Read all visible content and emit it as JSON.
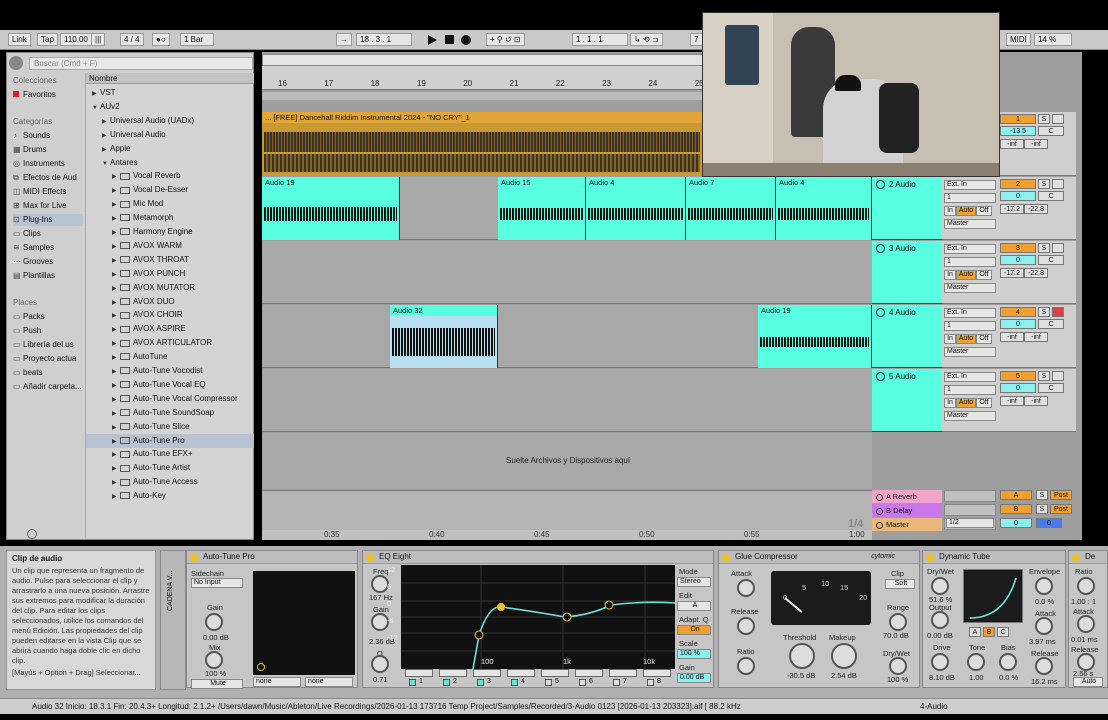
{
  "transport": {
    "link": "Link",
    "tap": "Tap",
    "tempo": "110.00",
    "signature": "4 / 4",
    "quantize": "1 Bar",
    "position": "18 .  3 .  1",
    "loop_start": "1 .  1 .  1",
    "loop_length": "7",
    "midi_label": "MIDI",
    "cpu": "14 %"
  },
  "browser": {
    "search_placeholder": "Buscar (Cmd + F)",
    "collections_header": "Colecciones",
    "favorites": "Favoritos",
    "categories_header": "Categorías",
    "categories": [
      "Sounds",
      "Drums",
      "Instruments",
      "Efectos de Aud",
      "MIDI Effects",
      "Max for Live",
      "Plug-Ins",
      "Clips",
      "Samples",
      "Grooves",
      "Plantillas"
    ],
    "places_header": "Places",
    "places": [
      "Packs",
      "Push",
      "Librería del us",
      "Proyecto actua",
      "beats",
      "Añadir carpeta..."
    ],
    "name_header": "Nombre",
    "tree": [
      {
        "label": "VST",
        "indent": 0,
        "arrow": "▶"
      },
      {
        "label": "AUv2",
        "indent": 0,
        "arrow": "▼"
      },
      {
        "label": "Universal Audio (UADx)",
        "indent": 1,
        "arrow": "▶"
      },
      {
        "label": "Universal Audio",
        "indent": 1,
        "arrow": "▶"
      },
      {
        "label": "Apple",
        "indent": 1,
        "arrow": "▶"
      },
      {
        "label": "Antares",
        "indent": 1,
        "arrow": "▼"
      },
      {
        "label": "Vocal Reverb",
        "indent": 2,
        "arrow": "▶"
      },
      {
        "label": "Vocal De-Esser",
        "indent": 2,
        "arrow": "▶"
      },
      {
        "label": "Mic Mod",
        "indent": 2,
        "arrow": "▶"
      },
      {
        "label": "Metamorph",
        "indent": 2,
        "arrow": "▶"
      },
      {
        "label": "Harmony Engine",
        "indent": 2,
        "arrow": "▶"
      },
      {
        "label": "AVOX WARM",
        "indent": 2,
        "arrow": "▶"
      },
      {
        "label": "AVOX THROAT",
        "indent": 2,
        "arrow": "▶"
      },
      {
        "label": "AVOX PUNCH",
        "indent": 2,
        "arrow": "▶"
      },
      {
        "label": "AVOX MUTATOR",
        "indent": 2,
        "arrow": "▶"
      },
      {
        "label": "AVOX DUO",
        "indent": 2,
        "arrow": "▶"
      },
      {
        "label": "AVOX CHOIR",
        "indent": 2,
        "arrow": "▶"
      },
      {
        "label": "AVOX ASPIRE",
        "indent": 2,
        "arrow": "▶"
      },
      {
        "label": "AVOX ARTICULATOR",
        "indent": 2,
        "arrow": "▶"
      },
      {
        "label": "AutoTune",
        "indent": 2,
        "arrow": "▶"
      },
      {
        "label": "Auto-Tune Vocodist",
        "indent": 2,
        "arrow": "▶"
      },
      {
        "label": "Auto-Tune Vocal EQ",
        "indent": 2,
        "arrow": "▶"
      },
      {
        "label": "Auto-Tune Vocal Compressor",
        "indent": 2,
        "arrow": "▶"
      },
      {
        "label": "Auto-Tune SoundSoap",
        "indent": 2,
        "arrow": "▶"
      },
      {
        "label": "Auto-Tune Slice",
        "indent": 2,
        "arrow": "▶"
      },
      {
        "label": "Auto-Tune Pro",
        "indent": 2,
        "arrow": "▶"
      },
      {
        "label": "Auto-Tune EFX+",
        "indent": 2,
        "arrow": "▶"
      },
      {
        "label": "Auto-Tune Artist",
        "indent": 2,
        "arrow": "▶"
      },
      {
        "label": "Auto-Tune Access",
        "indent": 2,
        "arrow": "▶"
      },
      {
        "label": "Auto-Key",
        "indent": 2,
        "arrow": "▶"
      }
    ],
    "selected_item": "Auto-Tune Pro"
  },
  "arrangement": {
    "bars": [
      "16",
      "17",
      "18",
      "19",
      "20",
      "21",
      "22",
      "23",
      "24",
      "25"
    ],
    "time_marks": [
      "0:35",
      "0:40",
      "0:45",
      "0:50",
      "0:55",
      "1:00"
    ],
    "drop_text": "Suelte Archivos y Dispositivos aquí",
    "zoom_ratio": "1/4"
  },
  "tracks": [
    {
      "name": "1 Audio",
      "num": "1",
      "vol": "-13.5",
      "pan": "C",
      "peak_l": "-inf",
      "peak_r": "-inf",
      "clips": [
        {
          "name": "... [FREE] Dancehall Riddim Instrumental 2024 - \"NO CRY\"_1",
          "color": "#e0a437"
        }
      ]
    },
    {
      "name": "2 Audio",
      "num": "2",
      "input_type": "Ext. In",
      "input_channel": "1",
      "monitor": [
        "In",
        "Auto",
        "Off"
      ],
      "output": "Master",
      "vol": "0",
      "pan": "C",
      "peak_l": "-17.2",
      "peak_r": "-22.8",
      "clips": [
        {
          "name": "Audio 19"
        },
        {
          "name": "Audio 15"
        },
        {
          "name": "Audio 4"
        },
        {
          "name": "Audio 7"
        },
        {
          "name": "Audio 4"
        }
      ]
    },
    {
      "name": "3 Audio",
      "num": "3",
      "input_type": "Ext. In",
      "input_channel": "1",
      "monitor": [
        "In",
        "Auto",
        "Off"
      ],
      "output": "Master",
      "vol": "0",
      "pan": "C",
      "peak_l": "-17.2",
      "peak_r": "-22.8",
      "clips": []
    },
    {
      "name": "4 Audio",
      "num": "4",
      "input_type": "Ext. In",
      "input_channel": "1",
      "monitor": [
        "In",
        "Auto",
        "Off"
      ],
      "output": "Master",
      "vol": "0",
      "pan": "C",
      "peak_l": "-inf",
      "peak_r": "-inf",
      "clips": [
        {
          "name": "Audio 32"
        },
        {
          "name": "Audio 19"
        }
      ]
    },
    {
      "name": "5 Audio",
      "num": "5",
      "input_type": "Ext. In",
      "input_channel": "1",
      "monitor": [
        "In",
        "Auto",
        "Off"
      ],
      "output": "Master",
      "vol": "0",
      "pan": "C",
      "peak_l": "-inf",
      "peak_r": "-inf",
      "clips": []
    }
  ],
  "returns": [
    {
      "name": "A Reverb",
      "letter": "A",
      "color": "#f4a4c8"
    },
    {
      "name": "B Delay",
      "letter": "B",
      "color": "#c878e8"
    },
    {
      "name": "Master",
      "letter": "",
      "color": "#e8b878",
      "output": "1/2",
      "vol": "0",
      "pan": "0"
    }
  ],
  "info_panel": {
    "title": "Clip de audio",
    "body": "Un clip que representa un fragmento de audio. Pulse para seleccionar el clip y arrastrarlo a una nueva posición. Arrastre sus extremos para modificar la duración del clip. Para editar los clips seleccionados, utilice los comandos del menú Edición. Las propiedades del clip pueden editarse en la vista Clip que se abrirá cuando haga doble clic en dicho clip.",
    "shortcut": "[Mayús + Option + Drag] Seleccionar..."
  },
  "devices": {
    "chain_label": "CADENA V...",
    "autotune": {
      "title": "Auto-Tune Pro",
      "sidechain": "Sidechain",
      "input": "No Input",
      "gain_label": "Gain",
      "gain": "0.00 dB",
      "mix_label": "Mix",
      "mix": "100 %",
      "mute": "Mute",
      "sel1": "none",
      "sel2": "none"
    },
    "eq": {
      "title": "EQ Eight",
      "freq_label": "Freq",
      "freq": "167 Hz",
      "gain_label": "Gain",
      "gain": "2.36 dB",
      "q_label": "Q",
      "q": "0.71",
      "mode_label": "Mode",
      "mode": "Stereo",
      "edit_label": "Edit",
      "edit": "A",
      "adapt_label": "Adapt. Q",
      "adapt": "On",
      "scale_label": "Scale",
      "scale": "100 %",
      "out_gain_label": "Gain",
      "out_gain": "0.00 dB",
      "y_ticks": [
        "12",
        "6",
        "0",
        "-6",
        "-12"
      ],
      "x_ticks": [
        "100",
        "1k",
        "10k"
      ],
      "bands": [
        "1",
        "2",
        "3",
        "4",
        "5",
        "6",
        "7",
        "8"
      ]
    },
    "glue": {
      "title": "Glue Compressor",
      "brand": "cytomic",
      "attack_label": "Attack",
      "release_label": "Release",
      "ratio_label": "Ratio",
      "clip_label": "Clip",
      "clip": "Soft",
      "range_label": "Range",
      "range": "70.0 dB",
      "drywet_label": "Dry/Wet",
      "drywet": "100 %",
      "threshold_label": "Threshold",
      "threshold": "-30.5 dB",
      "makeup_label": "Makeup",
      "makeup": "2.54 dB",
      "meter_ticks": [
        "0",
        "5",
        "10",
        "15",
        "20"
      ]
    },
    "tube": {
      "title": "Dynamic Tube",
      "drywet_label": "Dry/Wet",
      "drywet": "51.6 %",
      "output_label": "Output",
      "output": "0.00 dB",
      "drive_label": "Drive",
      "drive": "8.10 dB",
      "tone_label": "Tone",
      "tone": "1.00",
      "bias_label": "Bias",
      "bias": "0.0 %",
      "envelope_label": "Envelope",
      "envelope": "0.0 %",
      "attack_label": "Attack",
      "attack": "3.97 ms",
      "release_label": "Release",
      "release": "16.2 ms",
      "tubes": [
        "A",
        "B",
        "C"
      ]
    },
    "partial": {
      "title": "De",
      "ratio_label": "Ratio",
      "ratio": "1.00 : 1",
      "attack_label": "Attack",
      "attack": "0.01 ms",
      "release_label": "Release",
      "release": "2.56 s",
      "auto": "Auto"
    }
  },
  "status": {
    "text": "Audio 32  Inicio: 18.3.1  Fin: 20.4.3+  Longitud: 2.1.2+  /Users/dawn/Music/Ableton/Live Recordings/2026-01-13 173716 Temp Project/Samples/Recorded/3-Audio 0123 [2026-01-13 203323].aif [ 88.2 kHz",
    "track_label": "4-Audio"
  }
}
